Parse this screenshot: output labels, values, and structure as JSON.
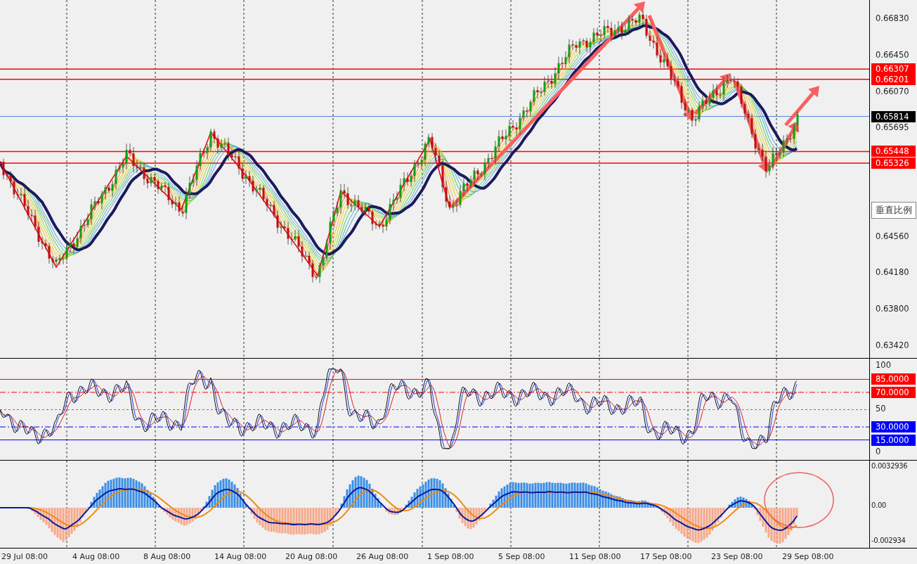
{
  "price_axis": {
    "ticks": [
      "0.66830",
      "0.66450",
      "0.66070",
      "0.65695",
      "0.64560",
      "0.64180",
      "0.63800",
      "0.63420"
    ]
  },
  "price_tags": [
    {
      "text": "0.66307",
      "kind": "level",
      "color": "#ff0000"
    },
    {
      "text": "0.66201",
      "kind": "level",
      "color": "#ff0000"
    },
    {
      "text": "0.65814",
      "kind": "current",
      "color": "#000000"
    },
    {
      "text": "0.65448",
      "kind": "level",
      "color": "#ff0000"
    },
    {
      "text": "0.65326",
      "kind": "level",
      "color": "#ff0000"
    }
  ],
  "tooltip": {
    "text": "垂直比例"
  },
  "rsi_axis": {
    "ticks": [
      "100",
      "50",
      "0"
    ]
  },
  "rsi_levels": [
    {
      "text": "85.0000",
      "kind": "solid",
      "color": "#ff0000"
    },
    {
      "text": "70.0000",
      "kind": "dashdot",
      "color": "#ff0000"
    },
    {
      "text": "30.0000",
      "kind": "dashdot",
      "color": "#0000ff"
    },
    {
      "text": "15.0000",
      "kind": "solid",
      "color": "#0000ff"
    }
  ],
  "macd_axis": {
    "ticks": [
      "0.0032936",
      "0.00",
      "-0.002934"
    ]
  },
  "time_axis": {
    "labels": [
      "29 Jul 08:00",
      "4 Aug 08:00",
      "8 Aug 08:00",
      "14 Aug 08:00",
      "20 Aug 08:00",
      "26 Aug 08:00",
      "1 Sep 08:00",
      "5 Sep 08:00",
      "11 Sep 08:00",
      "17 Sep 08:00",
      "23 Sep 08:00",
      "29 Sep 08:00"
    ]
  }
}
